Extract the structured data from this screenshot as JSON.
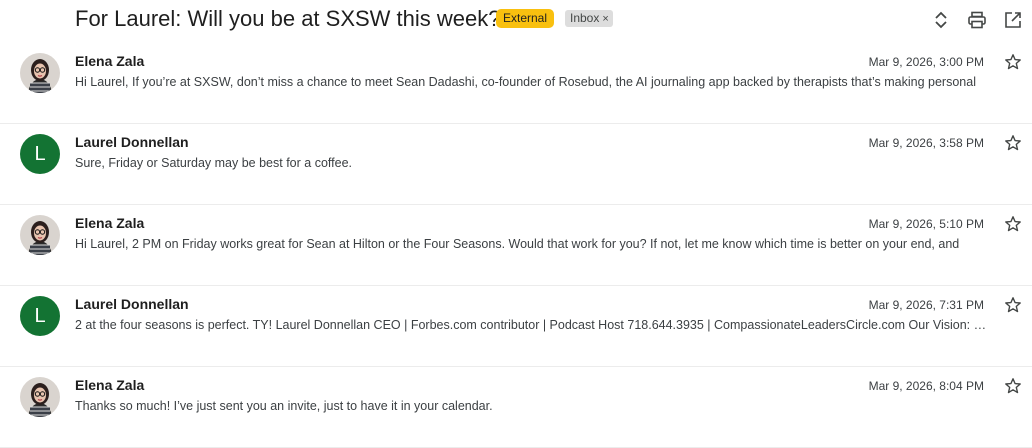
{
  "thread": {
    "subject": "For Laurel: Will you be at SXSW this week?",
    "labels": {
      "external": "External",
      "inbox": "Inbox",
      "remove": "×"
    },
    "actions": [
      "expand-collapse-icon",
      "print-icon",
      "open-in-new-window-icon"
    ]
  },
  "messages": [
    {
      "sender": "Elena Zala",
      "date": "Mar 9, 2026, 3:00 PM",
      "snippet": "Hi Laurel, If you’re at SXSW, don’t miss a chance to meet Sean Dadashi, co-founder of Rosebud, the AI journaling app backed by therapists that’s making personal",
      "avatar": "photo"
    },
    {
      "sender": "Laurel Donnellan",
      "date": "Mar 9, 2026, 3:58 PM",
      "snippet": "Sure, Friday or Saturday may be best for a coffee.",
      "avatar": "L",
      "avatar_color": "#137333"
    },
    {
      "sender": "Elena Zala",
      "date": "Mar 9, 2026, 5:10 PM",
      "snippet": "Hi Laurel, 2 PM on Friday works great for Sean at Hilton or the Four Seasons. Would that work for you? If not, let me know which time is better on your end, and",
      "avatar": "photo"
    },
    {
      "sender": "Laurel Donnellan",
      "date": "Mar 9, 2026, 7:31 PM",
      "snippet": "2 at the four seasons is perfect. TY! Laurel Donnellan CEO | Forbes.com contributor | Podcast Host 718.644.3935 | CompassionateLeadersCircle.com Our Vision: …",
      "avatar": "L",
      "avatar_color": "#137333"
    },
    {
      "sender": "Elena Zala",
      "date": "Mar 9, 2026, 8:04 PM",
      "snippet": "Thanks so much! I’ve just sent you an invite, just to have it in your calendar.",
      "avatar": "photo"
    }
  ]
}
